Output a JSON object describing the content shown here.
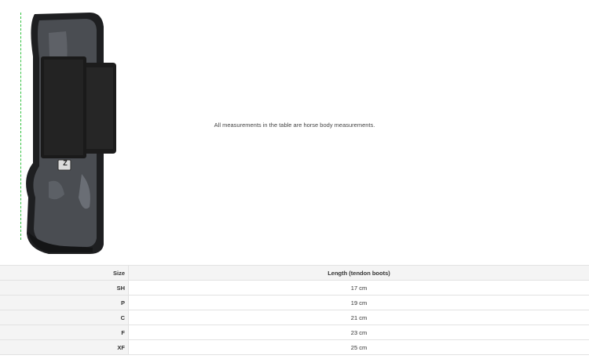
{
  "note": "All measurements in the table are horse body measurements.",
  "product_image": {
    "icon": "tendon-boot-image",
    "logo_letter": "Z"
  },
  "table": {
    "headers": {
      "size": "Size",
      "length": "Length (tendon boots)"
    },
    "rows": [
      {
        "size": "SH",
        "length": "17 cm"
      },
      {
        "size": "P",
        "length": "19 cm"
      },
      {
        "size": "C",
        "length": "21 cm"
      },
      {
        "size": "F",
        "length": "23 cm"
      },
      {
        "size": "XF",
        "length": "25 cm"
      }
    ]
  },
  "colors": {
    "measure_line": "#2fc13d",
    "boot_body": "#4a4d52",
    "strap": "#1c1c1c",
    "header_bg": "#f4f4f4"
  }
}
